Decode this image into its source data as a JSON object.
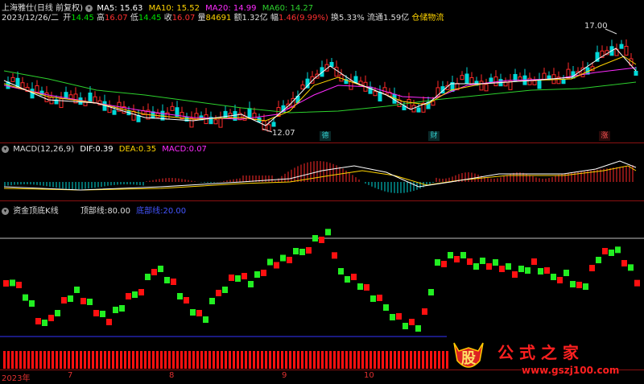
{
  "header": {
    "stock_name": "上海雅仕(日线 前复权)",
    "ma5_label": "MA5:",
    "ma5": "15.63",
    "ma10_label": "MA10:",
    "ma10": "15.52",
    "ma20_label": "MA20:",
    "ma20": "14.99",
    "ma60_label": "MA60:",
    "ma60": "14.27",
    "date": "2023/12/26/二",
    "open_label": "开",
    "open": "14.45",
    "high_label": "高",
    "high": "16.07",
    "low_label": "低",
    "low": "14.45",
    "close_label": "收",
    "close": "16.07",
    "vol_label": "量",
    "vol": "84691",
    "amount_label": "额",
    "amount": "1.32亿",
    "chg_label": "幅",
    "chg": "1.46(9.99%)",
    "turnover_label": "换",
    "turnover": "5.33%",
    "float_label": "流通",
    "float": "1.59亿",
    "concept": "仓储物流"
  },
  "price_marks": {
    "high_value": "17.00",
    "low_value": "12.07"
  },
  "event_markers": [
    "德",
    "财",
    "涨"
  ],
  "macd": {
    "title": "MACD(12,26,9)",
    "dif_label": "DIF:",
    "dif": "0.39",
    "dea_label": "DEA:",
    "dea": "0.35",
    "macd_label": "MACD:",
    "macd": "0.07"
  },
  "indicator": {
    "title": "资金顶底K线",
    "top_label": "顶部线:",
    "top": "80.00",
    "bottom_label": "底部线:",
    "bottom": "20.00"
  },
  "x_axis": {
    "year": "2023年",
    "months": [
      "7",
      "8",
      "9",
      "10"
    ]
  },
  "watermark": {
    "site": "www.gszj100.com"
  },
  "colors": {
    "up": "#ff2a2a",
    "down": "#00d8d8",
    "ma5": "#ffffff",
    "ma10": "#ffd400",
    "ma20": "#ff2bff",
    "ma60": "#2dd12d",
    "ind_up": "#ff1010",
    "ind_down": "#22ee22",
    "bottom_line": "#3333ff",
    "top_line": "#c0c0c0"
  }
}
